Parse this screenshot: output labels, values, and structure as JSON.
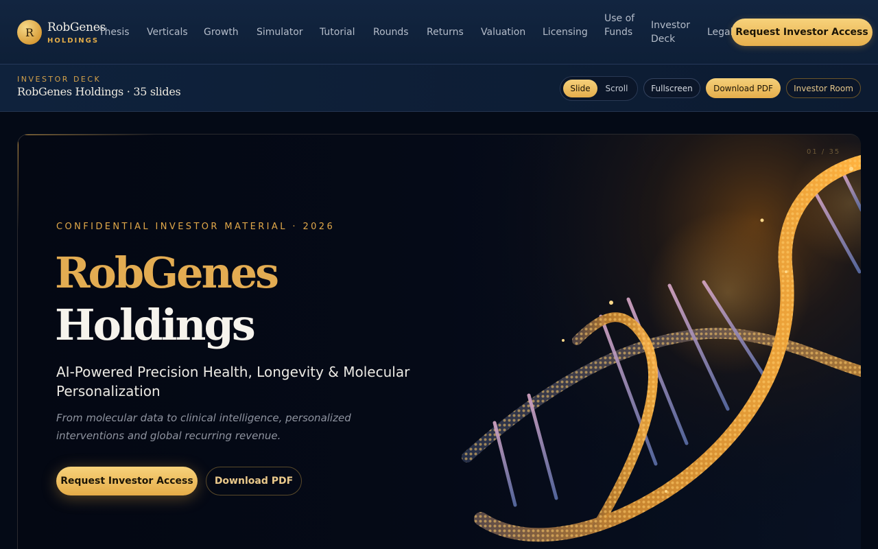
{
  "brand": {
    "logo_letter": "R",
    "name": "RobGenes",
    "sub": "HOLDINGS"
  },
  "nav": {
    "items": [
      "Thesis",
      "Verticals",
      "Growth",
      "Simulator",
      "Tutorial",
      "Rounds",
      "Returns",
      "Valuation",
      "Licensing",
      "Use of Funds",
      "Investor Deck",
      "Legal"
    ],
    "cta": "Request Investor Access"
  },
  "deckbar": {
    "eyebrow": "INVESTOR DECK",
    "title": "RobGenes Holdings · 35 slides",
    "mode_slide": "Slide",
    "mode_scroll": "Scroll",
    "fullscreen": "Fullscreen",
    "download_pdf": "Download PDF",
    "investor_room": "Investor Room"
  },
  "hero": {
    "counter": "01 / 35",
    "eyebrow": "CONFIDENTIAL INVESTOR MATERIAL · 2026",
    "title_line1": "RobGenes",
    "title_line2": "Holdings",
    "subhead": "AI-Powered Precision Health, Longevity & Molecular Personalization",
    "lede": "From molecular data to clinical intelligence, personalized interventions and global recurring revenue.",
    "primary_cta": "Request Investor Access",
    "secondary_cta": "Download PDF"
  },
  "colors": {
    "accent_gold": "#e3ac52",
    "nav_bg": "#122540",
    "page_bg": "#040a16"
  },
  "icons": {
    "logo": "brand-logo-mark",
    "hero_visual": "dna-helix-illustration"
  }
}
